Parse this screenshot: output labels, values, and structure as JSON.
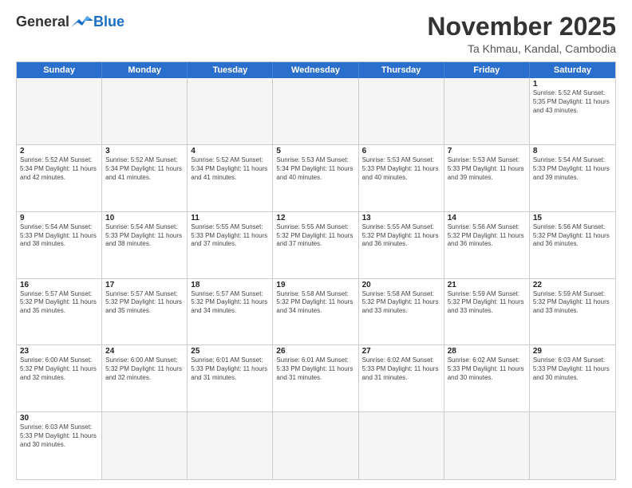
{
  "header": {
    "logo_general": "General",
    "logo_blue": "Blue",
    "month_title": "November 2025",
    "location": "Ta Khmau, Kandal, Cambodia"
  },
  "calendar": {
    "days": [
      "Sunday",
      "Monday",
      "Tuesday",
      "Wednesday",
      "Thursday",
      "Friday",
      "Saturday"
    ],
    "rows": [
      [
        {
          "day": "",
          "empty": true,
          "text": ""
        },
        {
          "day": "",
          "empty": true,
          "text": ""
        },
        {
          "day": "",
          "empty": true,
          "text": ""
        },
        {
          "day": "",
          "empty": true,
          "text": ""
        },
        {
          "day": "",
          "empty": true,
          "text": ""
        },
        {
          "day": "",
          "empty": true,
          "text": ""
        },
        {
          "day": "1",
          "empty": false,
          "text": "Sunrise: 5:52 AM\nSunset: 5:35 PM\nDaylight: 11 hours\nand 43 minutes."
        }
      ],
      [
        {
          "day": "2",
          "empty": false,
          "text": "Sunrise: 5:52 AM\nSunset: 5:34 PM\nDaylight: 11 hours\nand 42 minutes."
        },
        {
          "day": "3",
          "empty": false,
          "text": "Sunrise: 5:52 AM\nSunset: 5:34 PM\nDaylight: 11 hours\nand 41 minutes."
        },
        {
          "day": "4",
          "empty": false,
          "text": "Sunrise: 5:52 AM\nSunset: 5:34 PM\nDaylight: 11 hours\nand 41 minutes."
        },
        {
          "day": "5",
          "empty": false,
          "text": "Sunrise: 5:53 AM\nSunset: 5:34 PM\nDaylight: 11 hours\nand 40 minutes."
        },
        {
          "day": "6",
          "empty": false,
          "text": "Sunrise: 5:53 AM\nSunset: 5:33 PM\nDaylight: 11 hours\nand 40 minutes."
        },
        {
          "day": "7",
          "empty": false,
          "text": "Sunrise: 5:53 AM\nSunset: 5:33 PM\nDaylight: 11 hours\nand 39 minutes."
        },
        {
          "day": "8",
          "empty": false,
          "text": "Sunrise: 5:54 AM\nSunset: 5:33 PM\nDaylight: 11 hours\nand 39 minutes."
        }
      ],
      [
        {
          "day": "9",
          "empty": false,
          "text": "Sunrise: 5:54 AM\nSunset: 5:33 PM\nDaylight: 11 hours\nand 38 minutes."
        },
        {
          "day": "10",
          "empty": false,
          "text": "Sunrise: 5:54 AM\nSunset: 5:33 PM\nDaylight: 11 hours\nand 38 minutes."
        },
        {
          "day": "11",
          "empty": false,
          "text": "Sunrise: 5:55 AM\nSunset: 5:33 PM\nDaylight: 11 hours\nand 37 minutes."
        },
        {
          "day": "12",
          "empty": false,
          "text": "Sunrise: 5:55 AM\nSunset: 5:32 PM\nDaylight: 11 hours\nand 37 minutes."
        },
        {
          "day": "13",
          "empty": false,
          "text": "Sunrise: 5:55 AM\nSunset: 5:32 PM\nDaylight: 11 hours\nand 36 minutes."
        },
        {
          "day": "14",
          "empty": false,
          "text": "Sunrise: 5:56 AM\nSunset: 5:32 PM\nDaylight: 11 hours\nand 36 minutes."
        },
        {
          "day": "15",
          "empty": false,
          "text": "Sunrise: 5:56 AM\nSunset: 5:32 PM\nDaylight: 11 hours\nand 36 minutes."
        }
      ],
      [
        {
          "day": "16",
          "empty": false,
          "text": "Sunrise: 5:57 AM\nSunset: 5:32 PM\nDaylight: 11 hours\nand 35 minutes."
        },
        {
          "day": "17",
          "empty": false,
          "text": "Sunrise: 5:57 AM\nSunset: 5:32 PM\nDaylight: 11 hours\nand 35 minutes."
        },
        {
          "day": "18",
          "empty": false,
          "text": "Sunrise: 5:57 AM\nSunset: 5:32 PM\nDaylight: 11 hours\nand 34 minutes."
        },
        {
          "day": "19",
          "empty": false,
          "text": "Sunrise: 5:58 AM\nSunset: 5:32 PM\nDaylight: 11 hours\nand 34 minutes."
        },
        {
          "day": "20",
          "empty": false,
          "text": "Sunrise: 5:58 AM\nSunset: 5:32 PM\nDaylight: 11 hours\nand 33 minutes."
        },
        {
          "day": "21",
          "empty": false,
          "text": "Sunrise: 5:59 AM\nSunset: 5:32 PM\nDaylight: 11 hours\nand 33 minutes."
        },
        {
          "day": "22",
          "empty": false,
          "text": "Sunrise: 5:59 AM\nSunset: 5:32 PM\nDaylight: 11 hours\nand 33 minutes."
        }
      ],
      [
        {
          "day": "23",
          "empty": false,
          "text": "Sunrise: 6:00 AM\nSunset: 5:32 PM\nDaylight: 11 hours\nand 32 minutes."
        },
        {
          "day": "24",
          "empty": false,
          "text": "Sunrise: 6:00 AM\nSunset: 5:32 PM\nDaylight: 11 hours\nand 32 minutes."
        },
        {
          "day": "25",
          "empty": false,
          "text": "Sunrise: 6:01 AM\nSunset: 5:33 PM\nDaylight: 11 hours\nand 31 minutes."
        },
        {
          "day": "26",
          "empty": false,
          "text": "Sunrise: 6:01 AM\nSunset: 5:33 PM\nDaylight: 11 hours\nand 31 minutes."
        },
        {
          "day": "27",
          "empty": false,
          "text": "Sunrise: 6:02 AM\nSunset: 5:33 PM\nDaylight: 11 hours\nand 31 minutes."
        },
        {
          "day": "28",
          "empty": false,
          "text": "Sunrise: 6:02 AM\nSunset: 5:33 PM\nDaylight: 11 hours\nand 30 minutes."
        },
        {
          "day": "29",
          "empty": false,
          "text": "Sunrise: 6:03 AM\nSunset: 5:33 PM\nDaylight: 11 hours\nand 30 minutes."
        }
      ],
      [
        {
          "day": "30",
          "empty": false,
          "text": "Sunrise: 6:03 AM\nSunset: 5:33 PM\nDaylight: 11 hours\nand 30 minutes."
        },
        {
          "day": "",
          "empty": true,
          "text": ""
        },
        {
          "day": "",
          "empty": true,
          "text": ""
        },
        {
          "day": "",
          "empty": true,
          "text": ""
        },
        {
          "day": "",
          "empty": true,
          "text": ""
        },
        {
          "day": "",
          "empty": true,
          "text": ""
        },
        {
          "day": "",
          "empty": true,
          "text": ""
        }
      ]
    ]
  }
}
